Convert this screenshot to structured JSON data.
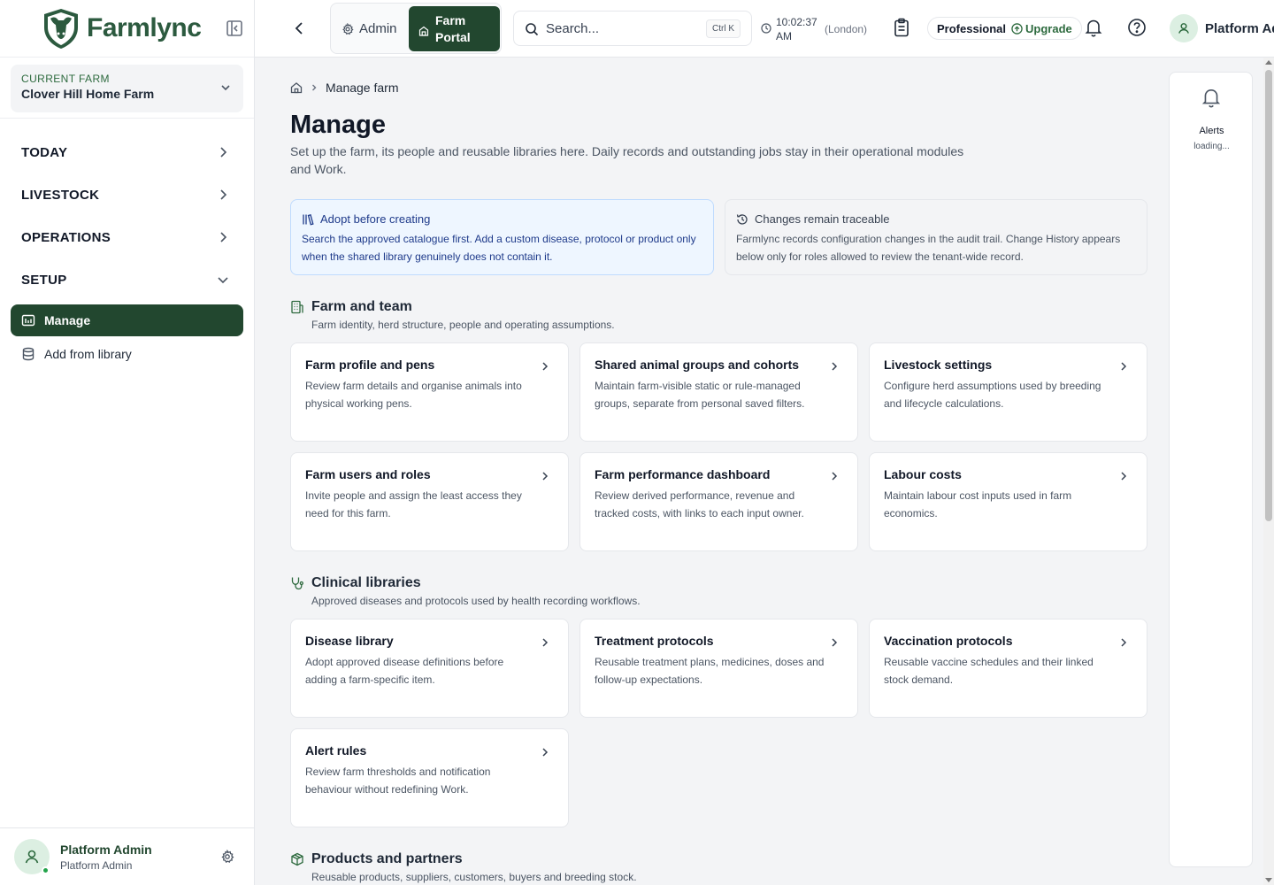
{
  "brand": {
    "name": "Farmlync",
    "color": "#2c5a3f"
  },
  "sidebar": {
    "current_farm_label": "CURRENT FARM",
    "current_farm_name": "Clover Hill Home Farm",
    "sections": [
      {
        "label": "TODAY",
        "expanded": false
      },
      {
        "label": "LIVESTOCK",
        "expanded": false
      },
      {
        "label": "OPERATIONS",
        "expanded": false
      },
      {
        "label": "SETUP",
        "expanded": true
      }
    ],
    "setup_items": [
      {
        "label": "Manage",
        "active": true,
        "icon": "manage-icon"
      },
      {
        "label": "Add from library",
        "active": false,
        "icon": "database-icon"
      }
    ],
    "user": {
      "name": "Platform Admin",
      "role": "Platform Admin",
      "status": "online"
    }
  },
  "header": {
    "admin_label": "Admin",
    "portal_label": "Farm Portal",
    "search_placeholder": "Search...",
    "search_shortcut": "Ctrl K",
    "time": "10:02:37 AM",
    "timezone": "(London)",
    "plan": "Professional",
    "upgrade_label": "Upgrade",
    "user_name": "Platform Admin"
  },
  "main": {
    "breadcrumb_current": "Manage farm",
    "title": "Manage",
    "description": "Set up the farm, its people and reusable libraries here. Daily records and outstanding jobs stay in their operational modules and Work.",
    "notes": [
      {
        "title": "Adopt before creating",
        "body": "Search the approved catalogue first. Add a custom disease, protocol or product only when the shared library genuinely does not contain it."
      },
      {
        "title": "Changes remain traceable",
        "body": "Farmlync records configuration changes in the audit trail. Change History appears below only for roles allowed to review the tenant-wide record."
      }
    ],
    "sections": [
      {
        "title": "Farm and team",
        "description": "Farm identity, herd structure, people and operating assumptions.",
        "cards": [
          {
            "title": "Farm profile and pens",
            "description": "Review farm details and organise animals into physical working pens."
          },
          {
            "title": "Shared animal groups and cohorts",
            "description": "Maintain farm-visible static or rule-managed groups, separate from personal saved filters."
          },
          {
            "title": "Livestock settings",
            "description": "Configure herd assumptions used by breeding and lifecycle calculations."
          },
          {
            "title": "Farm users and roles",
            "description": "Invite people and assign the least access they need for this farm."
          },
          {
            "title": "Farm performance dashboard",
            "description": "Review derived performance, revenue and tracked costs, with links to each input owner."
          },
          {
            "title": "Labour costs",
            "description": "Maintain labour cost inputs used in farm economics."
          }
        ]
      },
      {
        "title": "Clinical libraries",
        "description": "Approved diseases and protocols used by health recording workflows.",
        "cards": [
          {
            "title": "Disease library",
            "description": "Adopt approved disease definitions before adding a farm-specific item."
          },
          {
            "title": "Treatment protocols",
            "description": "Reusable treatment plans, medicines, doses and follow-up expectations."
          },
          {
            "title": "Vaccination protocols",
            "description": "Reusable vaccine schedules and their linked stock demand."
          },
          {
            "title": "Alert rules",
            "description": "Review farm thresholds and notification behaviour without redefining Work."
          }
        ]
      },
      {
        "title": "Products and partners",
        "description": "Reusable products, suppliers, customers, buyers and breeding stock.",
        "cards": []
      }
    ]
  },
  "alerts_panel": {
    "label": "Alerts",
    "status": "loading..."
  }
}
